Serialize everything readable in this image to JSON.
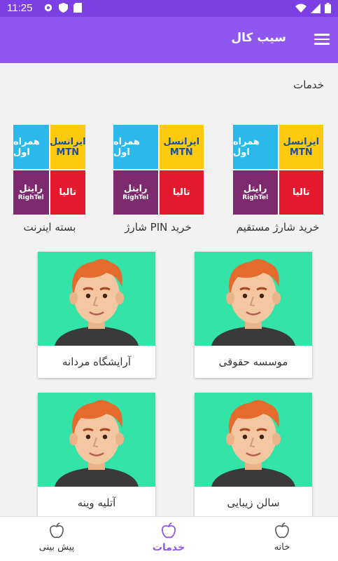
{
  "status_bar": {
    "time": "11:25",
    "left_icons": [
      "gear-icon",
      "shield-icon",
      "sd-card-icon"
    ],
    "right_icons": [
      "wifi-icon",
      "signal-icon",
      "battery-icon"
    ]
  },
  "app_bar": {
    "title": "سیب کال",
    "menu_icon": "hamburger-menu-icon",
    "color": "#8f57ef"
  },
  "section": {
    "title": "خدمات"
  },
  "operators_logo": {
    "irancell": "ایرانسل",
    "mtn": "MTN",
    "hamrahaval": "همراه اول",
    "rightel": "رایتل",
    "rightel_en": "RighTel",
    "talia": "تالیا"
  },
  "services": [
    {
      "label": "خرید شارژ مستقیم"
    },
    {
      "label": "خرید PIN شارژ"
    },
    {
      "label": "بسته اینرنت"
    }
  ],
  "cards": [
    {
      "label": "موسسه حقوقی"
    },
    {
      "label": "آرایشگاه مردانه"
    },
    {
      "label": "سالن زیبایی"
    },
    {
      "label": "آتلیه وینه"
    }
  ],
  "bottom_nav": [
    {
      "label": "خانه",
      "icon": "home-apple-icon",
      "active": false
    },
    {
      "label": "خدمات",
      "icon": "services-apple-icon",
      "active": true
    },
    {
      "label": "پیش بینی",
      "icon": "prediction-apple-icon",
      "active": false
    }
  ],
  "colors": {
    "accent": "#8f57ef",
    "status_bar": "#7b3fe4",
    "card_image_bg": "#33e3a8"
  }
}
